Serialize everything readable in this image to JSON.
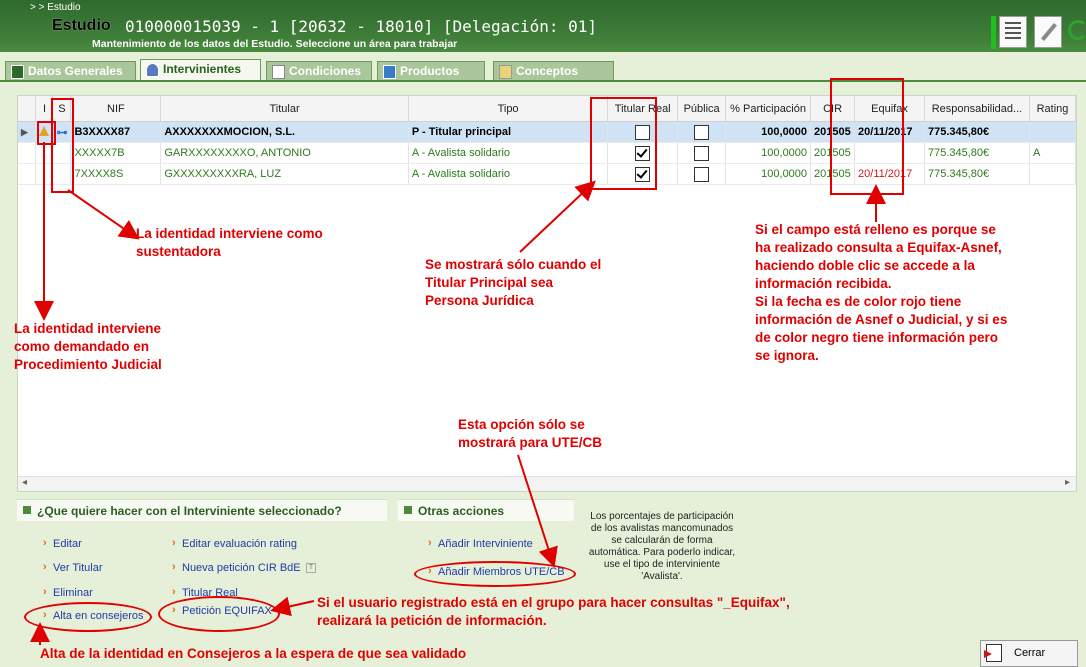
{
  "header": {
    "breadcrumb": ">    > Estudio",
    "title": "Estudio",
    "study_id": "010000015039 - 1 [20632 - 18010] [Delegación: 01]",
    "subtitle": "Mantenimiento de los datos del Estudio. Seleccione un área para trabajar"
  },
  "tabs": [
    "Datos Generales",
    "Intervinientes",
    "Condiciones",
    "Productos",
    "Conceptos"
  ],
  "table": {
    "headers": [
      "I",
      "S",
      "NIF",
      "Titular",
      "Tipo",
      "Titular Real",
      "Pública",
      "% Participación",
      "CIR",
      "Equifax",
      "Responsabilidad...",
      "Rating"
    ],
    "rows": [
      {
        "nif": "B3XXXX87",
        "titular": "AXXXXXXXMOCION, S.L.",
        "tipo": "P - Titular principal",
        "titular_real": false,
        "publica": false,
        "participacion": "100,0000",
        "cir": "201505",
        "equifax": "20/11/2017",
        "resp": "775.345,80€",
        "rating": ""
      },
      {
        "nif": "XXXXX7B",
        "titular": "GARXXXXXXXXO, ANTONIO",
        "tipo": "A - Avalista solidario",
        "titular_real": true,
        "publica": false,
        "participacion": "100,0000",
        "cir": "201505",
        "equifax": "",
        "resp": "775.345,80€",
        "rating": "A"
      },
      {
        "nif": "7XXXX8S",
        "titular": "GXXXXXXXXXRA, LUZ",
        "tipo": "A - Avalista solidario",
        "titular_real": true,
        "publica": false,
        "participacion": "100,0000",
        "cir": "201505",
        "equifax": "20/11/2017",
        "resp": "775.345,80€",
        "rating": ""
      }
    ]
  },
  "actions": {
    "section_title": "¿Que quiere hacer con el Interviniente seleccionado?",
    "col1": [
      "Editar",
      "Ver Titular",
      "Eliminar",
      "Alta en consejeros"
    ],
    "col2": [
      "Editar evaluación rating",
      "Nueva petición CIR BdE",
      "Titular Real",
      "Petición EQUIFAX"
    ]
  },
  "other_actions": {
    "title": "Otras acciones",
    "items": [
      "Añadir Interviniente",
      "Añadir Miembros UTE/CB"
    ],
    "note": "Los porcentajes de participación de los avalistas mancomunados se calcularán de forma automática. Para poderlo indicar, use el tipo de interviniente 'Avalista'."
  },
  "close_label": "Cerrar",
  "annotations": {
    "sustentadora": "La identidad interviene como\nsustentadora",
    "demandado": "La identidad interviene\ncomo demandado en\nProcedimiento Judicial",
    "titular_real": "Se mostrará sólo cuando el\nTitular Principal sea\nPersona Jurídica",
    "equifax": "Si el campo está relleno es porque se\nha realizado consulta a Equifax-Asnef,\nhaciendo doble clic se accede a la\ninformación recibida.\nSi la fecha es de color rojo tiene\ninformación de Asnef o Judicial, y si es\nde color negro tiene información pero\nse ignora.",
    "ute": "Esta opción sólo se\nmostrará para UTE/CB",
    "equifax_group": "Si el usuario registrado está en el grupo para hacer consultas \"_Equifax\",\nrealizará la petición de información.",
    "consejeros": "Alta de la identidad en Consejeros a la espera de que sea validado"
  }
}
